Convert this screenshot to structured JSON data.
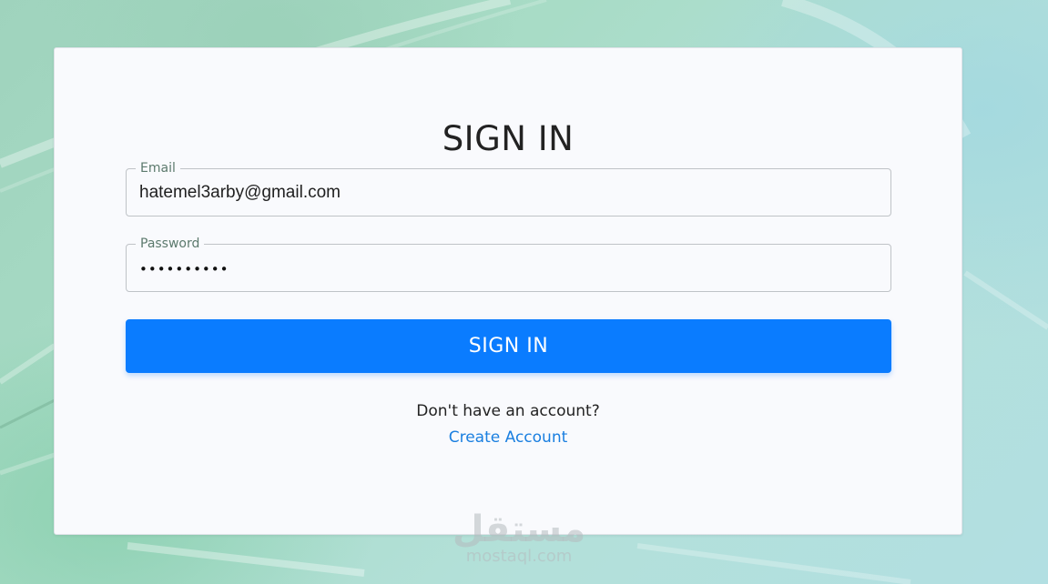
{
  "signin": {
    "title": "SIGN IN",
    "email": {
      "label": "Email",
      "value": "hatemel3arby@gmail.com"
    },
    "password": {
      "label": "Password",
      "value": "••••••••••"
    },
    "submit_label": "SIGN IN",
    "no_account_prompt": "Don't have an account?",
    "create_account_label": "Create Account"
  },
  "watermark": {
    "arabic": "مستقل",
    "latin": "mostaql.com"
  },
  "colors": {
    "accent": "#0a7cff",
    "link": "#1a7fe0",
    "card_bg": "#f9fafd",
    "field_label": "#5c7a6d"
  }
}
